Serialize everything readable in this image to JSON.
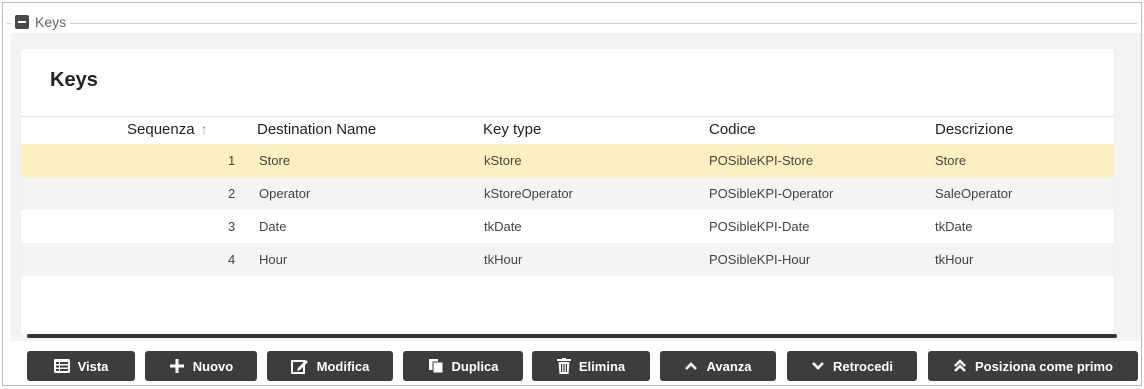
{
  "fieldset": {
    "label": "Keys"
  },
  "panel": {
    "title": "Keys"
  },
  "table": {
    "columns": [
      "Sequenza",
      "Destination Name",
      "Key type",
      "Codice",
      "Descrizione"
    ],
    "sort_indicator": "↑",
    "rows": [
      {
        "seq": "1",
        "dest": "Store",
        "type": "kStore",
        "code": "POSibleKPI-Store",
        "desc": "Store"
      },
      {
        "seq": "2",
        "dest": "Operator",
        "type": "kStoreOperator",
        "code": "POSibleKPI-Operator",
        "desc": "SaleOperator"
      },
      {
        "seq": "3",
        "dest": "Date",
        "type": "tkDate",
        "code": "POSibleKPI-Date",
        "desc": "tkDate"
      },
      {
        "seq": "4",
        "dest": "Hour",
        "type": "tkHour",
        "code": "POSibleKPI-Hour",
        "desc": "tkHour"
      }
    ]
  },
  "toolbar": {
    "vista": "Vista",
    "nuovo": "Nuovo",
    "modifica": "Modifica",
    "duplica": "Duplica",
    "elimina": "Elimina",
    "avanza": "Avanza",
    "retrocedi": "Retrocedi",
    "posiziona": "Posiziona come primo"
  },
  "colors": {
    "selected_row": "#fdf0c0",
    "alt_row": "#f4f4f4",
    "button_bg": "#3d3d3d"
  }
}
